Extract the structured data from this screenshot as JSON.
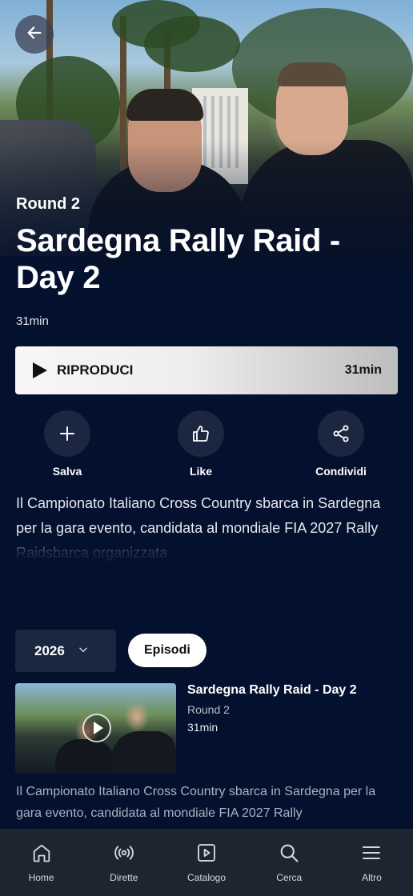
{
  "header": {
    "back_icon": "arrow-left-icon"
  },
  "hero": {
    "round": "Round 2",
    "title": "Sardegna Rally Raid - Day 2",
    "duration": "31min"
  },
  "play_button": {
    "label": "RIPRODUCI",
    "duration": "31min",
    "icon": "play-icon"
  },
  "actions": [
    {
      "label": "Salva",
      "icon": "plus-icon"
    },
    {
      "label": "Like",
      "icon": "thumbs-up-icon"
    },
    {
      "label": "Condividi",
      "icon": "share-icon"
    }
  ],
  "description": "Il Campionato Italiano Cross Country sbarca in Sardegna per la gara evento, candidata al mondiale FIA 2027 Rally Raidsbarca organizzata",
  "season_select": {
    "value": "2026",
    "icon": "chevron-down-icon"
  },
  "tab_chip": {
    "label": "Episodi"
  },
  "episodes": [
    {
      "title": "Sardegna Rally Raid - Day 2",
      "round": "Round 2",
      "duration": "31min",
      "description": "Il Campionato Italiano Cross Country sbarca in Sardegna per la gara evento, candidata al mondiale FIA 2027 Rally"
    }
  ],
  "tabbar": [
    {
      "label": "Home",
      "icon": "home-icon"
    },
    {
      "label": "Dirette",
      "icon": "broadcast-icon"
    },
    {
      "label": "Catalogo",
      "icon": "catalog-play-icon"
    },
    {
      "label": "Cerca",
      "icon": "search-icon"
    },
    {
      "label": "Altro",
      "icon": "menu-icon"
    }
  ],
  "colors": {
    "background": "#04112e",
    "surface": "#1b2640",
    "tabbar": "#1e2430"
  }
}
